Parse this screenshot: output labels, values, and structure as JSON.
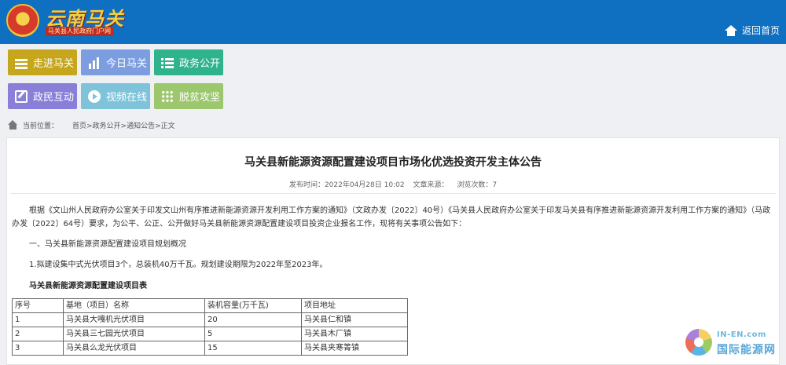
{
  "header": {
    "logo_text": "云南马关",
    "logo_subtitle": "马关县人民政府门户网",
    "home_link": "返回首页"
  },
  "nav": {
    "tiles": [
      {
        "label": "走进马关",
        "icon": "layers-icon"
      },
      {
        "label": "今日马关",
        "icon": "bar-chart-icon"
      },
      {
        "label": "政务公开",
        "icon": "list-icon"
      },
      {
        "label": "政民互动",
        "icon": "edit-icon"
      },
      {
        "label": "视频在线",
        "icon": "play-icon"
      },
      {
        "label": "脱贫攻坚",
        "icon": "grid-icon"
      }
    ]
  },
  "breadcrumb": {
    "current_label": "当前位置：",
    "path": "首页>政务公开>通知公告>正文"
  },
  "article": {
    "title": "马关县新能源资源配置建设项目市场化优选投资开发主体公告",
    "publish_time": "发布时间：2022年04月28日 10:02",
    "source": "文章来源：",
    "views": "浏览次数：7",
    "paragraph1": "根据《文山州人民政府办公室关于印发文山州有序推进新能源资源开发利用工作方案的通知》（文政办发〔2022〕40号）《马关县人民政府办公室关于印发马关县有序推进新能源资源开发利用工作方案的通知》（马政办发〔2022〕64号）要求，为公平、公正、公开做好马关县新能源资源配置建设项目投资企业报名工作，现将有关事项公告如下：",
    "paragraph2": "一、马关县新能源资源配置建设项目规划概况",
    "paragraph3": "1.拟建设集中式光伏项目3个，总装机40万千瓦。规划建设期限为2022年至2023年。",
    "table_title": "马关县新能源资源配置建设项目表",
    "table": {
      "headers": [
        "序号",
        "基地（项目）名称",
        "装机容量(万千瓦)",
        "项目地址"
      ],
      "rows": [
        [
          "1",
          "马关县大嘎机光伏项目",
          "20",
          "马关县仁和镇"
        ],
        [
          "2",
          "马关县三七园光伏项目",
          "5",
          "马关县木厂镇"
        ],
        [
          "3",
          "马关县么龙光伏项目",
          "15",
          "马关县夹寒箐镇"
        ]
      ]
    }
  },
  "watermark": {
    "en": "IN-EN.com",
    "cn": "国际能源网"
  }
}
